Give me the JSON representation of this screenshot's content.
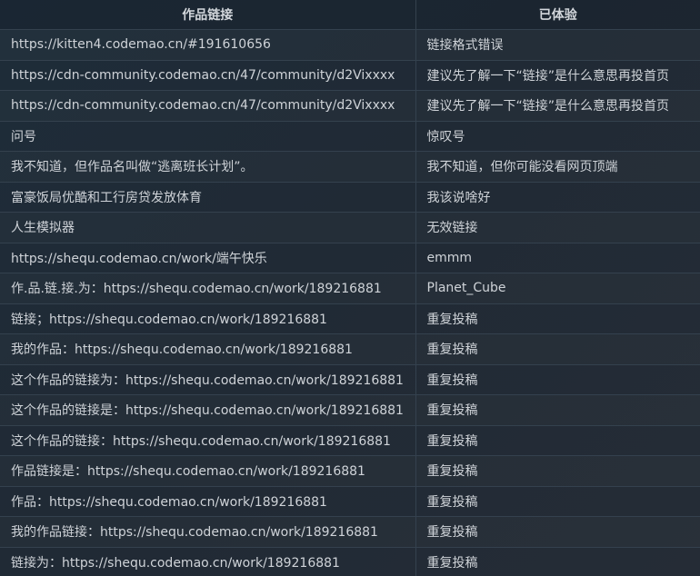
{
  "table": {
    "headers": [
      "作品链接",
      "已体验"
    ],
    "rows": [
      [
        "https://kitten4.codemao.cn/#191610656",
        "链接格式错误"
      ],
      [
        "https://cdn-community.codemao.cn/47/community/d2Vixxxx",
        "建议先了解一下“链接”是什么意思再投首页"
      ],
      [
        "https://cdn-community.codemao.cn/47/community/d2Vixxxx",
        "建议先了解一下“链接”是什么意思再投首页"
      ],
      [
        "问号",
        "惊叹号"
      ],
      [
        "我不知道，但作品名叫做“逃离班长计划”。",
        "我不知道，但你可能没看网页顶端"
      ],
      [
        "富豪饭局优酷和工行房贷发放体育",
        "我该说啥好"
      ],
      [
        "人生模拟器",
        "无效链接"
      ],
      [
        "https://shequ.codemao.cn/work/端午快乐",
        "emmm"
      ],
      [
        "作.品.链.接.为：https://shequ.codemao.cn/work/189216881",
        "Planet_Cube"
      ],
      [
        "链接；https://shequ.codemao.cn/work/189216881",
        "重复投稿"
      ],
      [
        "我的作品：https://shequ.codemao.cn/work/189216881",
        "重复投稿"
      ],
      [
        "这个作品的链接为：https://shequ.codemao.cn/work/189216881",
        "重复投稿"
      ],
      [
        "这个作品的链接是：https://shequ.codemao.cn/work/189216881",
        "重复投稿"
      ],
      [
        "这个作品的链接：https://shequ.codemao.cn/work/189216881",
        "重复投稿"
      ],
      [
        "作品链接是：https://shequ.codemao.cn/work/189216881",
        "重复投稿"
      ],
      [
        "作品：https://shequ.codemao.cn/work/189216881",
        "重复投稿"
      ],
      [
        "我的作品链接：https://shequ.codemao.cn/work/189216881",
        "重复投稿"
      ],
      [
        "链接为：https://shequ.codemao.cn/work/189216881",
        "重复投稿"
      ]
    ]
  }
}
